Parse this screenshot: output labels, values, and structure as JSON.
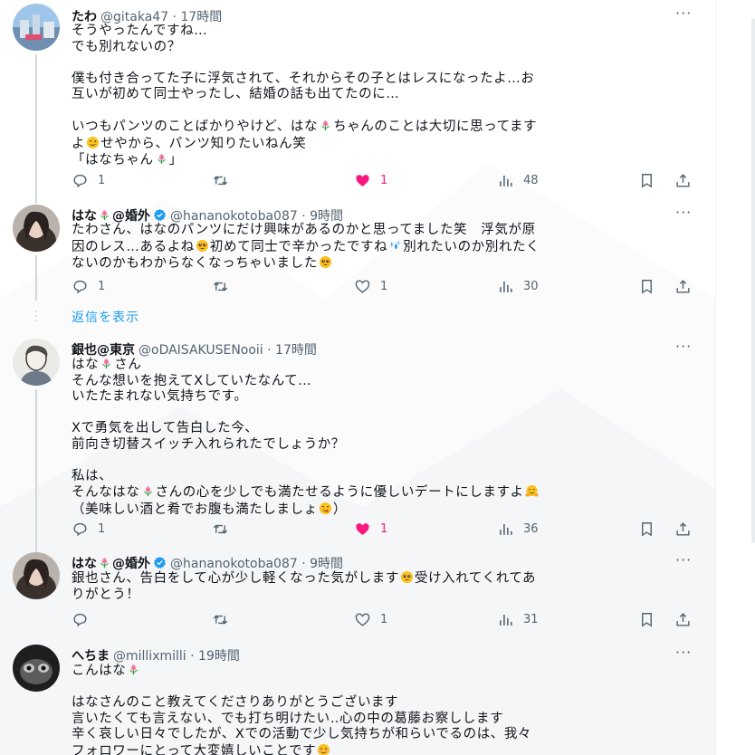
{
  "tweets": [
    {
      "name": "たわ",
      "handle": "@gitaka47",
      "time": "17時間",
      "lines": [
        "そうやったんですね…",
        "でも別れないの？",
        "",
        "僕も付き合ってた子に浮気されて、それからその子とはレスになったよ…お",
        "互いが初めて同士やったし、結婚の話も出てたのに…",
        "",
        "いつもパンツのことばかりやけど、はな[flower]ちゃんのことは大切に思ってます",
        "よ[wink]せやから、パンツ知りたいねん笑",
        "「はなちゃん[flower]」"
      ],
      "stats": {
        "reply": "1",
        "retweet": "",
        "like": "1",
        "views": "48"
      },
      "liked": true
    },
    {
      "name": "はな[flower]@婚外",
      "handle": "@hananokotoba087",
      "time": "9時間",
      "verified": true,
      "lines": [
        "たわさん、はなのパンツにだけ興味があるのかと思ってました笑　浮気が原",
        "因のレス…あるよね[pleading]初めて同士で辛かったですね[sweat]別れたいのか別れたく",
        "ないのかもわからなくなっちゃいました[pleading]"
      ],
      "stats": {
        "reply": "1",
        "retweet": "",
        "like": "1",
        "views": "30"
      },
      "liked": false
    },
    {
      "name": "銀也@東京",
      "handle": "@oDAISAKUSENooii",
      "time": "17時間",
      "lines": [
        "はな[flower]さん",
        "そんな想いを抱えてXしていたなんて…",
        "いたたまれない気持ちです。",
        "",
        "Xで勇気を出して告白した今、",
        "前向き切替スイッチ入れられたでしょうか？",
        "",
        "私は、",
        "そんなはな[flower]さんの心を少しでも満たせるように優しいデートにしますよ[hug]",
        "（美味しい酒と肴でお腹も満たしましょ[yum]）"
      ],
      "stats": {
        "reply": "1",
        "retweet": "",
        "like": "1",
        "views": "36"
      },
      "liked": true
    },
    {
      "name": "はな[flower]@婚外",
      "handle": "@hananokotoba087",
      "time": "9時間",
      "verified": true,
      "lines": [
        "銀也さん、告白をして心が少し軽くなった気がします[pleading]受け入れてくれてあ",
        "りがとう！"
      ],
      "stats": {
        "reply": "",
        "retweet": "",
        "like": "1",
        "views": "31"
      },
      "liked": false
    },
    {
      "name": "へちま",
      "handle": "@millixmilli",
      "time": "19時間",
      "lines": [
        "こんはな[flower]",
        "",
        "はなさんのこと教えてくださりありがとうございます",
        "言いたくても言えない、でも打ち明けたい‥心の中の葛藤お察しします",
        "辛く哀しい日々でしたが、Xでの活動で少し気持ちが和らいでるのは、我々",
        "フォロワーにとって大変嬉しいことです[smile]"
      ],
      "stats": {},
      "liked": false
    }
  ],
  "show_replies": "返信を表示",
  "colors": {
    "accent": "#1d9bf0",
    "like": "#f91880",
    "muted": "#536471",
    "text": "#0f1419"
  },
  "icons": [
    "reply-icon",
    "retweet-icon",
    "heart-icon",
    "views-icon",
    "bookmark-icon",
    "share-icon",
    "verified-icon",
    "more-icon"
  ]
}
